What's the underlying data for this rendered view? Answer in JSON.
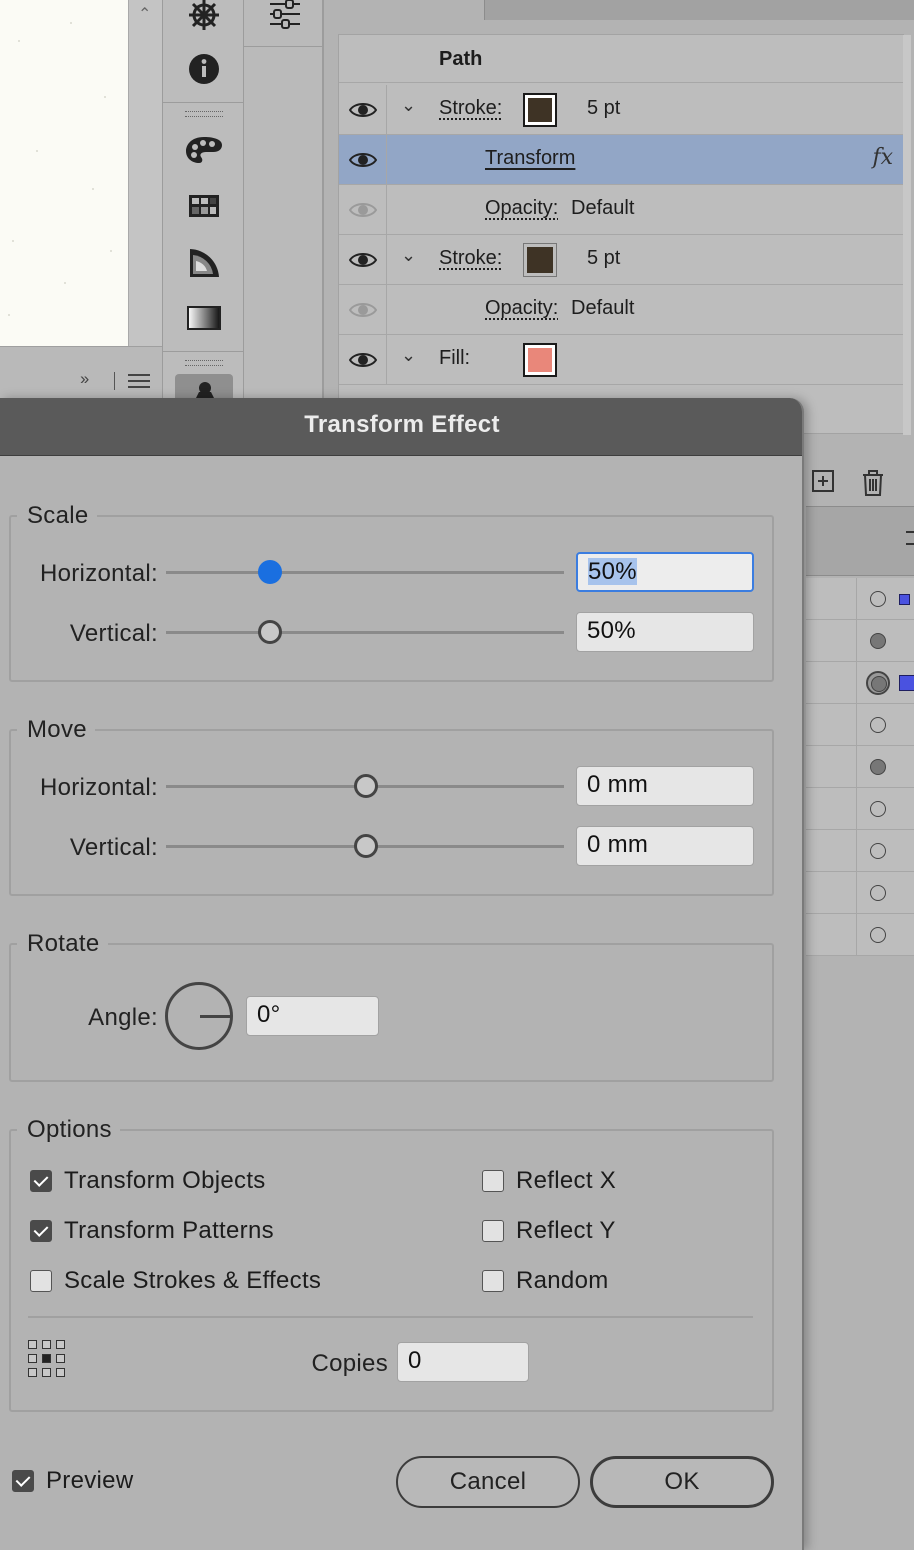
{
  "colors": {
    "selected_row": "#92a6c6",
    "stroke1_color": "#3e3325",
    "stroke2_color": "#3e3325",
    "fill_color": "#e9877a",
    "slider_active": "#1a6fe0",
    "layer_selection": "#4a52e0"
  },
  "toolbar_icons": [
    "ship-wheel-icon",
    "info-icon",
    "color-palette-icon",
    "swatches-grid-icon",
    "gradient-sector-icon",
    "gradient-icon",
    "puppet-warp-icon"
  ],
  "appearance": {
    "header": "Path",
    "rows": [
      {
        "label": "Stroke:",
        "value": "5 pt",
        "visible": true,
        "expandable": true,
        "swatch": "stroke1_color"
      },
      {
        "label": "Transform",
        "fx": "fx",
        "visible": true,
        "selected": true
      },
      {
        "label": "Opacity:",
        "value": "Default",
        "visible": false
      },
      {
        "label": "Stroke:",
        "value": "5 pt",
        "visible": true,
        "expandable": true,
        "swatch": "stroke2_color"
      },
      {
        "label": "Opacity:",
        "value": "Default",
        "visible": false
      },
      {
        "label": "Fill:",
        "visible": true,
        "expandable": true,
        "swatch": "fill_color"
      }
    ]
  },
  "dialog": {
    "title": "Transform Effect",
    "scale": {
      "legend": "Scale",
      "horizontal_label": "Horizontal:",
      "horizontal_value": "50%",
      "horizontal_slider_fraction": 0.26,
      "vertical_label": "Vertical:",
      "vertical_value": "50%",
      "vertical_slider_fraction": 0.26
    },
    "move": {
      "legend": "Move",
      "horizontal_label": "Horizontal:",
      "horizontal_value": "0 mm",
      "horizontal_slider_fraction": 0.5,
      "vertical_label": "Vertical:",
      "vertical_value": "0 mm",
      "vertical_slider_fraction": 0.5
    },
    "rotate": {
      "legend": "Rotate",
      "angle_label": "Angle:",
      "angle_value": "0°"
    },
    "options": {
      "legend": "Options",
      "transform_objects": {
        "label": "Transform Objects",
        "checked": true
      },
      "transform_patterns": {
        "label": "Transform Patterns",
        "checked": true
      },
      "scale_strokes": {
        "label": "Scale Strokes & Effects",
        "checked": false
      },
      "reflect_x": {
        "label": "Reflect X",
        "checked": false
      },
      "reflect_y": {
        "label": "Reflect Y",
        "checked": false
      },
      "random": {
        "label": "Random",
        "checked": false
      },
      "copies_label": "Copies",
      "copies_value": "0"
    },
    "preview": {
      "label": "Preview",
      "checked": true
    },
    "cancel_label": "Cancel",
    "ok_label": "OK"
  }
}
